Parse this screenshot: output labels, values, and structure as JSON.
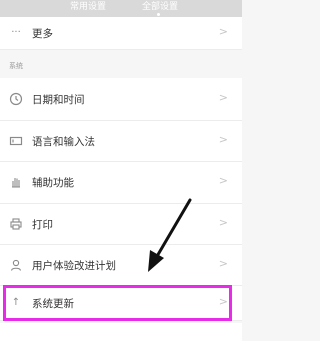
{
  "tabs": {
    "common": "常用设置",
    "all": "全部设置"
  },
  "more": {
    "label": "更多",
    "icon": "ellipsis-icon"
  },
  "section_title": "系统",
  "items": [
    {
      "label": "日期和时间",
      "icon": "clock-icon"
    },
    {
      "label": "语言和输入法",
      "icon": "keyboard-icon"
    },
    {
      "label": "辅助功能",
      "icon": "hand-icon"
    },
    {
      "label": "打印",
      "icon": "printer-icon"
    },
    {
      "label": "用户体验改进计划",
      "icon": "user-icon"
    },
    {
      "label": "系统更新",
      "icon": "arrow-up-icon"
    }
  ],
  "annotation": {
    "highlight_color": "#e62ce6",
    "arrow_color": "#111111"
  }
}
